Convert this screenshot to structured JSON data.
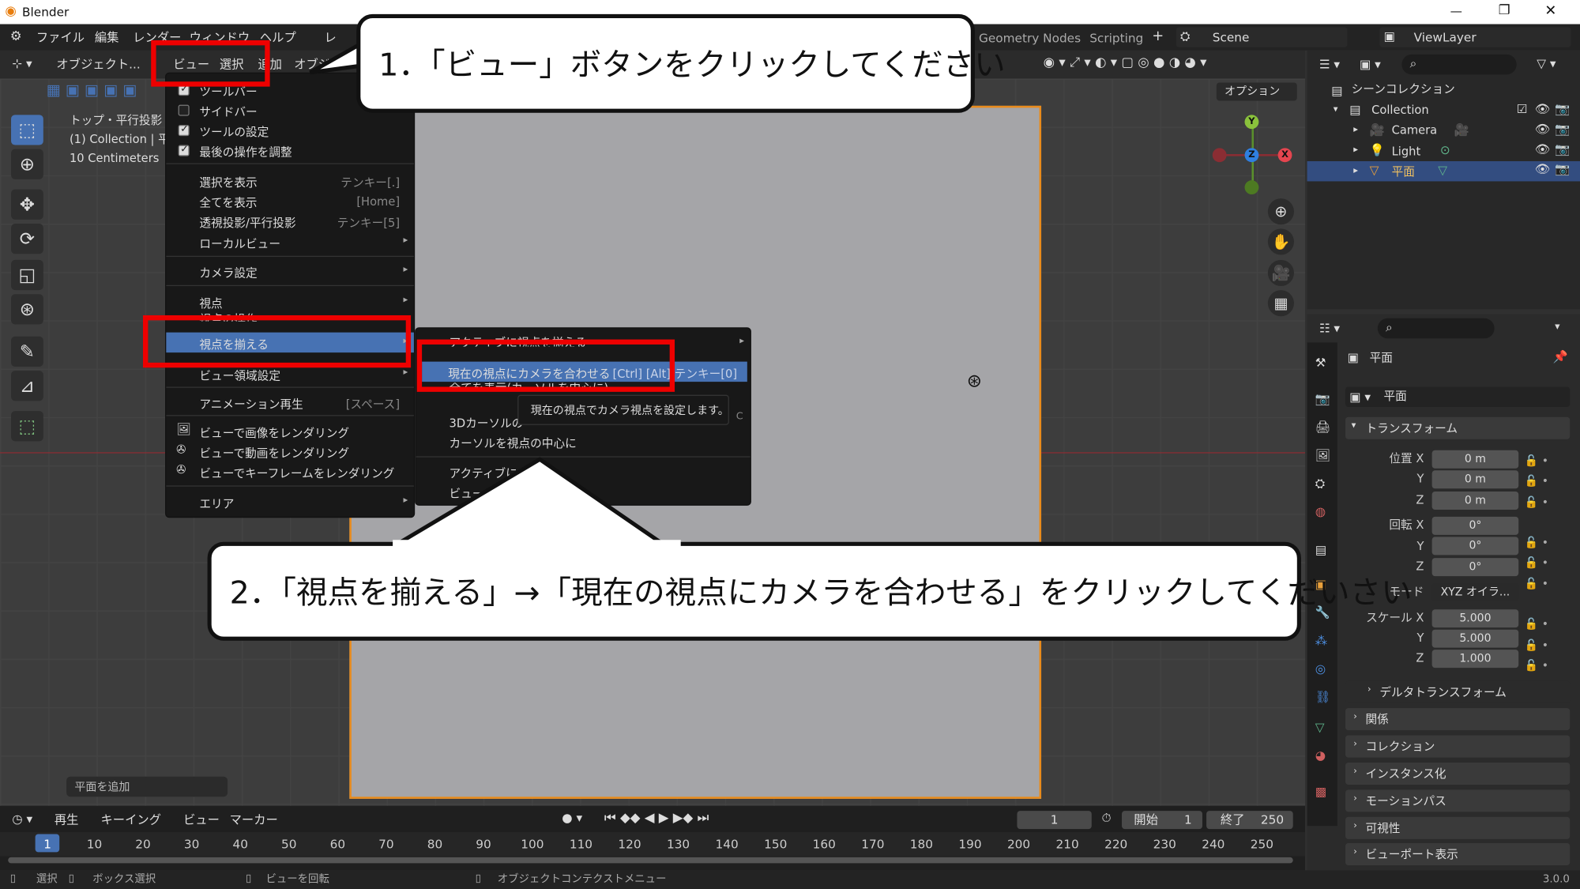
{
  "window": {
    "title": "Blender",
    "minimize": "—",
    "restore": "❐",
    "close": "✕"
  },
  "topbar": {
    "file": "ファイル",
    "edit": "編集",
    "render": "レンダー",
    "window": "ウィンドウ",
    "help": "ヘルプ",
    "ws_tab1": "レ",
    "ws_geo": "Geometry Nodes",
    "ws_scripting": "Scripting",
    "add_tab": "+",
    "scene": "Scene",
    "viewlayer": "ViewLayer"
  },
  "header": {
    "mode": "オブジェクト...",
    "menu_view": "ビュー",
    "menu_select": "選択",
    "menu_add": "追加",
    "menu_object": "オブジェクト",
    "options": "オプション"
  },
  "overlay_info": {
    "line1": "トップ・平行投影",
    "line2": "(1) Collection | 平面",
    "line3": "10 Centimeters"
  },
  "view_menu": {
    "items": [
      {
        "label": "ツールバー",
        "checked": true
      },
      {
        "label": "サイドバー",
        "checked": false
      },
      {
        "label": "ツールの設定",
        "checked": true
      },
      {
        "label": "最後の操作を調整",
        "checked": true
      },
      {
        "label": "選択を表示",
        "shortcut": "テンキー[.]"
      },
      {
        "label": "全てを表示",
        "shortcut": "[Home]"
      },
      {
        "label": "透視投影/平行投影",
        "shortcut": "テンキー[5]"
      },
      {
        "label": "ローカルビュー",
        "arrow": "▸"
      },
      {
        "label": "カメラ設定",
        "arrow": "▸"
      },
      {
        "label": "視点",
        "arrow": "▸"
      },
      {
        "label": "視点の操作"
      },
      {
        "label": "視点を揃える",
        "arrow": "▸"
      },
      {
        "label": "ビュー領域設定",
        "arrow": "▸"
      },
      {
        "label": "アニメーション再生",
        "shortcut": "[スペース]"
      },
      {
        "label": "ビューで画像をレンダリング"
      },
      {
        "label": "ビューで動画をレンダリング"
      },
      {
        "label": "ビューでキーフレームをレンダリング"
      },
      {
        "label": "エリア",
        "arrow": "▸"
      }
    ]
  },
  "submenu": {
    "active_align": "アクティブに視点を揃える",
    "camera_to_view": "現在の視点にカメラを合わせる",
    "camera_to_view_sc": "[Ctrl] [Alt] テンキー[0]",
    "view_all_center": "全てを表示(カーソルを中心に)",
    "cursor3d": "3Dカーソルの",
    "center_cursor": "カーソルを視点の中心に",
    "active_pre": "アクティブに",
    "view_lock": "ビュー",
    "tooltip": "現在の視点でカメラ視点を設定します。",
    "tooltip_suffix": "C"
  },
  "callouts": {
    "step1": "1．「ビュー」ボタンをクリックしてください",
    "step2": "2．「視点を揃える」→「現在の視点にカメラを合わせる」をクリックしてくだいさい"
  },
  "outliner": {
    "scene_collection": "シーンコレクション",
    "collection": "Collection",
    "camera": "Camera",
    "light": "Light",
    "plane": "平面"
  },
  "properties": {
    "object_name": "平面",
    "data_name": "平面",
    "transform": "トランスフォーム",
    "loc_label": "位置 X",
    "loc_x": "0 m",
    "loc_y": "0 m",
    "loc_z": "0 m",
    "rot_label": "回転 X",
    "rot_x": "0°",
    "rot_y": "0°",
    "rot_z": "0°",
    "mode_label": "モード",
    "mode_value": "XYZ オイラ...",
    "scale_label": "スケール X",
    "scale_x": "5.000",
    "scale_y": "5.000",
    "scale_z": "1.000",
    "y": "Y",
    "z": "Z",
    "delta": "デルタトランスフォーム",
    "relations": "関係",
    "collection": "コレクション",
    "instancing": "インスタンス化",
    "motion_path": "モーションパス",
    "visibility": "可視性",
    "viewport_display": "ビューポート表示"
  },
  "last_op": "平面を追加",
  "timeline": {
    "playback": "再生",
    "keying": "キーイング",
    "view": "ビュー",
    "marker": "マーカー",
    "current_frame": "1",
    "start_label": "開始",
    "start": "1",
    "end_label": "終了",
    "end": "250",
    "frames": [
      "1",
      "10",
      "20",
      "30",
      "40",
      "50",
      "60",
      "70",
      "80",
      "90",
      "100",
      "110",
      "120",
      "130",
      "140",
      "150",
      "160",
      "170",
      "180",
      "190",
      "200",
      "210",
      "220",
      "230",
      "240",
      "250"
    ]
  },
  "statusbar": {
    "select": "選択",
    "box_select": "ボックス選択",
    "rotate_view": "ビューを回転",
    "ctx_menu": "オブジェクトコンテクストメニュー",
    "version": "3.0.0"
  },
  "colors": {
    "accent": "#4772b3",
    "red_highlight": "#ee0000",
    "camera_border": "#e88b1c"
  }
}
